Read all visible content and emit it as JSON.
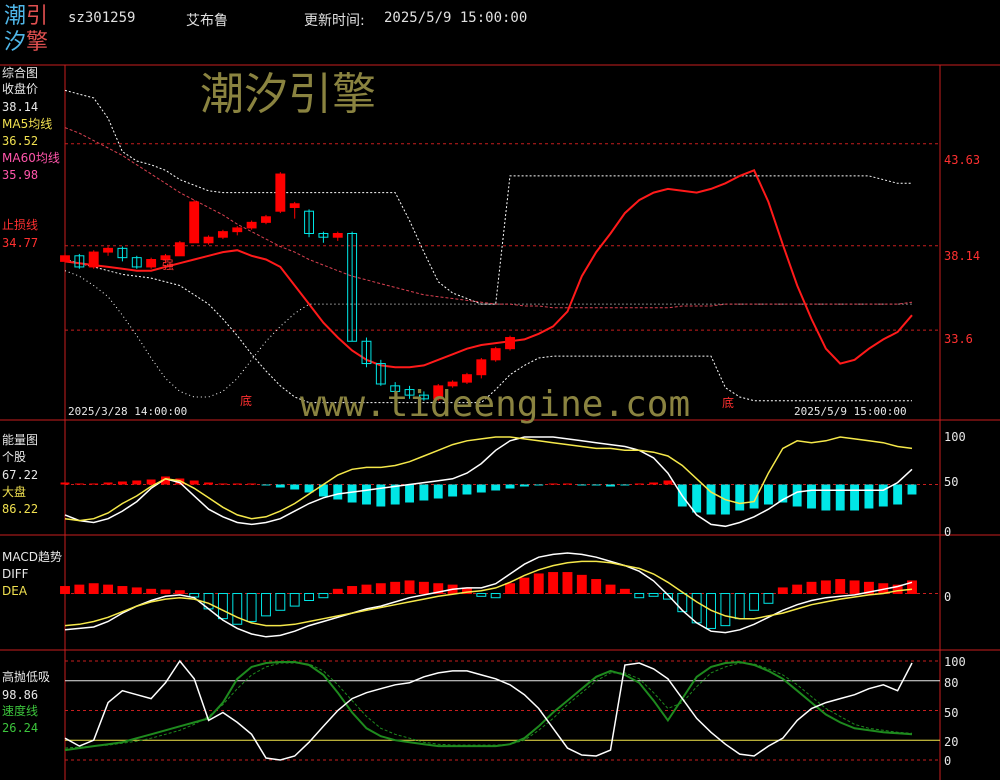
{
  "header": {
    "logo_line1_a": "潮",
    "logo_line1_b": "引",
    "logo_line2_a": "汐",
    "logo_line2_b": "擎",
    "code": "sz301259",
    "name": "艾布鲁",
    "update_label": "更新时间:",
    "update_time": "2025/5/9 15:00:00"
  },
  "watermarks": {
    "top": "潮汐引擎",
    "url": "www.tideengine.com"
  },
  "colors": {
    "up": "#ff0000",
    "down": "#00e6e6",
    "ma5": "#ff1a1a",
    "ma60": "#d84050",
    "divider": "#c81e1e",
    "white_line": "#ffffff",
    "yellow_line": "#f5e84a",
    "green_line": "#1e8a1e"
  },
  "panels": {
    "main": {
      "title": "综合图",
      "close_label": "收盘价",
      "close_value": "38.14",
      "ma5_label": "MA5均线",
      "ma5_value": "36.52",
      "ma60_label": "MA60均线",
      "ma60_value": "35.98",
      "stop_label": "止损线",
      "stop_value": "34.77",
      "right_ticks": [
        "43.63",
        "38.14",
        "33.6"
      ],
      "start_date": "2025/3/28 14:00:00",
      "end_date": "2025/5/9 15:00:00",
      "markers": [
        "强",
        "底",
        "底"
      ]
    },
    "energy": {
      "title": "能量图",
      "stock_label": "个股",
      "stock_value": "67.22",
      "market_label": "大盘",
      "market_value": "86.22",
      "right_ticks": [
        "100",
        "50",
        "0"
      ]
    },
    "macd": {
      "title": "MACD趋势",
      "diff_label": "DIFF",
      "dea_label": "DEA",
      "right_ticks": [
        "0"
      ]
    },
    "hilo": {
      "title": "高抛低吸",
      "white_value": "98.86",
      "speed_label": "速度线",
      "speed_value": "26.24",
      "right_ticks": [
        "100",
        "80",
        "50",
        "20",
        "0"
      ]
    }
  },
  "chart_data": {
    "type": "line",
    "num_bars": 60,
    "main": {
      "y_ticks": [
        43.63,
        38.14,
        33.6
      ],
      "ylim": [
        29.3,
        47.6
      ],
      "candles": [
        [
          37.3,
          37.6,
          37.2,
          37.8
        ],
        [
          37.6,
          37.0,
          36.9,
          37.7
        ],
        [
          37.0,
          37.8,
          36.9,
          37.9
        ],
        [
          37.8,
          38.0,
          37.6,
          38.1
        ],
        [
          38.0,
          37.5,
          37.3,
          38.1
        ],
        [
          37.5,
          37.0,
          36.9,
          37.6
        ],
        [
          37.0,
          37.4,
          36.9,
          37.5
        ],
        [
          37.4,
          37.6,
          37.2,
          37.7
        ],
        [
          37.6,
          38.3,
          37.6,
          38.4
        ],
        [
          38.3,
          40.5,
          38.3,
          40.6
        ],
        [
          38.3,
          38.6,
          38.2,
          38.7
        ],
        [
          38.6,
          38.9,
          38.5,
          39.0
        ],
        [
          38.9,
          39.1,
          38.7,
          39.2
        ],
        [
          39.1,
          39.4,
          39.0,
          39.5
        ],
        [
          39.4,
          39.7,
          39.3,
          39.8
        ],
        [
          40.0,
          42.0,
          39.9,
          42.1
        ],
        [
          40.2,
          40.4,
          39.6,
          40.5
        ],
        [
          40.0,
          38.8,
          38.6,
          40.1
        ],
        [
          38.8,
          38.6,
          38.3,
          38.9
        ],
        [
          38.6,
          38.8,
          38.4,
          38.9
        ],
        [
          38.8,
          33.0,
          33.0,
          38.9
        ],
        [
          33.0,
          31.8,
          31.6,
          33.2
        ],
        [
          31.8,
          30.7,
          30.6,
          32.0
        ],
        [
          30.6,
          30.3,
          30.2,
          30.8
        ],
        [
          30.4,
          30.1,
          29.9,
          30.6
        ],
        [
          30.1,
          29.9,
          29.8,
          30.3
        ],
        [
          29.9,
          30.6,
          29.8,
          30.7
        ],
        [
          30.6,
          30.8,
          30.5,
          30.9
        ],
        [
          30.8,
          31.2,
          30.7,
          31.3
        ],
        [
          31.2,
          32.0,
          31.0,
          32.1
        ],
        [
          32.0,
          32.6,
          31.9,
          32.7
        ],
        [
          32.6,
          33.2,
          32.5,
          33.3
        ]
      ],
      "ma5": [
        37.3,
        37.2,
        37.1,
        37.0,
        36.9,
        36.8,
        36.8,
        37.0,
        37.2,
        37.4,
        37.6,
        37.8,
        37.9,
        37.6,
        37.4,
        37.0,
        36.0,
        35.0,
        34.0,
        33.2,
        32.5,
        32.0,
        31.7,
        31.6,
        31.6,
        31.7,
        32.0,
        32.3,
        32.6,
        32.8,
        32.9,
        33.0,
        33.1,
        33.4,
        33.8,
        34.6,
        36.5,
        37.8,
        38.8,
        39.9,
        40.6,
        41.0,
        41.2,
        41.1,
        41.0,
        41.2,
        41.5,
        41.9,
        42.2,
        40.5,
        38.2,
        36.0,
        34.2,
        32.6,
        31.8,
        32.0,
        32.6,
        33.1,
        33.5,
        34.4
      ],
      "ma60": [
        44.5,
        44.2,
        43.8,
        43.4,
        43.0,
        42.5,
        42.0,
        41.5,
        41.0,
        40.6,
        40.2,
        39.8,
        39.3,
        38.9,
        38.5,
        38.1,
        37.8,
        37.4,
        37.1,
        36.8,
        36.5,
        36.3,
        36.1,
        35.9,
        35.7,
        35.5,
        35.4,
        35.3,
        35.2,
        35.1,
        35.0,
        35.0,
        34.9,
        34.9,
        34.8,
        34.8,
        34.8,
        34.8,
        34.8,
        34.8,
        34.8,
        34.8,
        34.8,
        34.9,
        34.9,
        34.9,
        35.0,
        35.0,
        35.0,
        35.0,
        35.0,
        35.0,
        35.0,
        35.0,
        35.0,
        35.0,
        35.0,
        35.0,
        35.0,
        35.1
      ],
      "upper": [
        46.5,
        46.3,
        46.1,
        45.0,
        43.2,
        42.7,
        42.5,
        42.2,
        41.7,
        41.4,
        41.1,
        41.0,
        41.0,
        41.0,
        41.0,
        41.0,
        41.0,
        41.0,
        41.0,
        41.0,
        41.0,
        41.0,
        41.0,
        41.0,
        39.5,
        37.8,
        36.2,
        35.6,
        35.3,
        35.0,
        35.0,
        41.9,
        41.9,
        41.9,
        41.9,
        41.9,
        41.9,
        41.9,
        41.9,
        41.9,
        41.9,
        41.9,
        41.9,
        41.9,
        41.9,
        41.9,
        41.9,
        41.9,
        41.9,
        41.9,
        41.9,
        41.9,
        41.9,
        41.9,
        41.9,
        41.9,
        41.9,
        41.7,
        41.5,
        41.5
      ],
      "lower": [
        37.4,
        37.2,
        37.0,
        36.8,
        36.6,
        36.5,
        36.4,
        36.2,
        36.0,
        35.5,
        35.0,
        34.2,
        33.3,
        32.3,
        31.4,
        30.6,
        30.0,
        29.7,
        29.7,
        29.7,
        29.7,
        29.7,
        29.7,
        29.7,
        29.7,
        29.7,
        29.7,
        29.7,
        29.7,
        29.7,
        30.4,
        31.2,
        31.7,
        32.1,
        32.2,
        32.2,
        32.2,
        32.2,
        32.2,
        32.2,
        32.2,
        32.2,
        32.2,
        32.2,
        32.2,
        32.2,
        30.5,
        30.0,
        29.8,
        29.8,
        29.8,
        29.8,
        29.8,
        29.8,
        29.8,
        29.8,
        29.8,
        29.8,
        29.8,
        29.8
      ],
      "dash_line": [
        36.8,
        36.5,
        36.0,
        35.4,
        34.4,
        33.3,
        32.1,
        31.0,
        30.3,
        30.0,
        30.0,
        30.3,
        31.0,
        32.0,
        33.0,
        33.8,
        34.5,
        35.0,
        35.0,
        35.0,
        35.0,
        35.0,
        35.0,
        35.0,
        35.0,
        35.0,
        35.0,
        35.0,
        35.0,
        35.0,
        35.0,
        35.0,
        35.0,
        35.0,
        35.0,
        35.0,
        35.0,
        35.0,
        35.0,
        35.0,
        35.0,
        35.0,
        35.0,
        35.0,
        35.0,
        35.0,
        35.0,
        35.0,
        35.0,
        35.0,
        35.0,
        35.0,
        35.0,
        35.0,
        35.0,
        35.0,
        35.0,
        35.0,
        35.0,
        35.0
      ]
    },
    "energy": {
      "ylim": [
        0,
        100
      ],
      "white": [
        18,
        12,
        10,
        14,
        22,
        32,
        46,
        56,
        52,
        38,
        24,
        16,
        10,
        8,
        10,
        14,
        22,
        30,
        36,
        40,
        42,
        44,
        46,
        48,
        50,
        52,
        54,
        56,
        62,
        72,
        86,
        96,
        100,
        100,
        100,
        98,
        96,
        94,
        92,
        90,
        86,
        78,
        62,
        38,
        18,
        8,
        6,
        10,
        16,
        24,
        34,
        42,
        44,
        44,
        44,
        44,
        44,
        44,
        52,
        66
      ],
      "yellow": [
        14,
        12,
        14,
        20,
        30,
        38,
        48,
        56,
        54,
        46,
        36,
        26,
        18,
        14,
        16,
        22,
        30,
        40,
        50,
        60,
        66,
        68,
        68,
        70,
        74,
        80,
        86,
        92,
        96,
        98,
        100,
        100,
        98,
        96,
        94,
        92,
        90,
        88,
        88,
        86,
        86,
        84,
        80,
        70,
        56,
        42,
        34,
        30,
        32,
        62,
        88,
        96,
        94,
        96,
        100,
        98,
        96,
        94,
        90,
        88
      ],
      "bars": [
        2,
        1,
        1,
        2,
        3,
        4,
        5,
        8,
        6,
        4,
        2,
        1,
        1,
        1,
        -1,
        -3,
        -5,
        -8,
        -12,
        -15,
        -18,
        -20,
        -22,
        -20,
        -18,
        -16,
        -14,
        -12,
        -10,
        -8,
        -6,
        -4,
        -2,
        -1,
        1,
        1,
        -1,
        -1,
        -2,
        -1,
        1,
        2,
        4,
        -22,
        -28,
        -30,
        -30,
        -26,
        -24,
        -20,
        -18,
        -22,
        -24,
        -26,
        -26,
        -26,
        -24,
        -22,
        -20,
        -10
      ]
    },
    "macd": {
      "ylim": [
        -0.78,
        0.58
      ],
      "diff": [
        -0.52,
        -0.5,
        -0.48,
        -0.4,
        -0.28,
        -0.18,
        -0.1,
        -0.04,
        -0.02,
        -0.06,
        -0.22,
        -0.38,
        -0.5,
        -0.58,
        -0.62,
        -0.6,
        -0.54,
        -0.46,
        -0.4,
        -0.34,
        -0.28,
        -0.22,
        -0.18,
        -0.12,
        -0.06,
        -0.02,
        0.02,
        0.06,
        0.08,
        0.08,
        0.14,
        0.28,
        0.42,
        0.52,
        0.56,
        0.58,
        0.56,
        0.52,
        0.46,
        0.4,
        0.32,
        0.18,
        -0.02,
        -0.24,
        -0.42,
        -0.54,
        -0.56,
        -0.52,
        -0.44,
        -0.34,
        -0.24,
        -0.16,
        -0.1,
        -0.06,
        -0.04,
        -0.02,
        0.02,
        0.06,
        0.1,
        0.16
      ],
      "dea": [
        -0.46,
        -0.44,
        -0.4,
        -0.34,
        -0.26,
        -0.18,
        -0.12,
        -0.08,
        -0.06,
        -0.08,
        -0.14,
        -0.24,
        -0.34,
        -0.42,
        -0.46,
        -0.46,
        -0.44,
        -0.4,
        -0.36,
        -0.32,
        -0.28,
        -0.24,
        -0.2,
        -0.16,
        -0.12,
        -0.08,
        -0.04,
        -0.01,
        0.02,
        0.04,
        0.08,
        0.16,
        0.26,
        0.34,
        0.4,
        0.44,
        0.46,
        0.46,
        0.44,
        0.4,
        0.36,
        0.28,
        0.16,
        0.02,
        -0.12,
        -0.24,
        -0.32,
        -0.36,
        -0.36,
        -0.32,
        -0.28,
        -0.22,
        -0.16,
        -0.12,
        -0.08,
        -0.05,
        -0.02,
        0.0,
        0.04,
        0.06
      ],
      "bars": [
        0.1,
        0.12,
        0.14,
        0.12,
        0.1,
        0.08,
        0.06,
        0.05,
        0.04,
        -0.05,
        -0.22,
        -0.36,
        -0.44,
        -0.4,
        -0.32,
        -0.24,
        -0.18,
        -0.1,
        -0.06,
        0.06,
        0.1,
        0.12,
        0.14,
        0.16,
        0.18,
        0.16,
        0.14,
        0.12,
        0.08,
        -0.04,
        -0.06,
        0.14,
        0.22,
        0.28,
        0.3,
        0.3,
        0.26,
        0.2,
        0.12,
        0.06,
        -0.06,
        -0.04,
        -0.08,
        -0.26,
        -0.42,
        -0.5,
        -0.46,
        -0.36,
        -0.24,
        -0.14,
        0.08,
        0.12,
        0.16,
        0.18,
        0.2,
        0.18,
        0.16,
        0.14,
        0.12,
        0.18
      ]
    },
    "hilo": {
      "ylim": [
        0,
        100
      ],
      "white": [
        22,
        14,
        20,
        58,
        70,
        66,
        62,
        78,
        100,
        82,
        40,
        48,
        38,
        26,
        2,
        0,
        4,
        18,
        34,
        50,
        62,
        68,
        72,
        76,
        78,
        84,
        88,
        90,
        90,
        86,
        82,
        76,
        66,
        52,
        32,
        12,
        5,
        4,
        10,
        96,
        98,
        92,
        82,
        62,
        42,
        28,
        16,
        6,
        4,
        14,
        22,
        40,
        52,
        58,
        62,
        66,
        72,
        76,
        70,
        98
      ],
      "green": [
        10,
        12,
        14,
        16,
        18,
        22,
        26,
        30,
        34,
        38,
        42,
        58,
        82,
        94,
        98,
        99,
        99,
        96,
        86,
        68,
        48,
        32,
        24,
        20,
        18,
        16,
        14,
        14,
        14,
        14,
        14,
        16,
        22,
        34,
        48,
        60,
        72,
        84,
        90,
        86,
        78,
        60,
        40,
        62,
        84,
        94,
        98,
        99,
        96,
        90,
        82,
        70,
        58,
        46,
        38,
        32,
        30,
        28,
        27,
        26
      ],
      "green_dashed": [
        12,
        13,
        14,
        15,
        17,
        19,
        22,
        26,
        30,
        36,
        44,
        56,
        72,
        86,
        94,
        98,
        98,
        97,
        90,
        76,
        60,
        44,
        32,
        26,
        22,
        18,
        16,
        15,
        15,
        15,
        15,
        16,
        20,
        30,
        42,
        56,
        68,
        80,
        88,
        88,
        82,
        68,
        52,
        58,
        74,
        88,
        94,
        98,
        97,
        92,
        86,
        76,
        64,
        52,
        44,
        36,
        32,
        30,
        28,
        27
      ]
    }
  }
}
